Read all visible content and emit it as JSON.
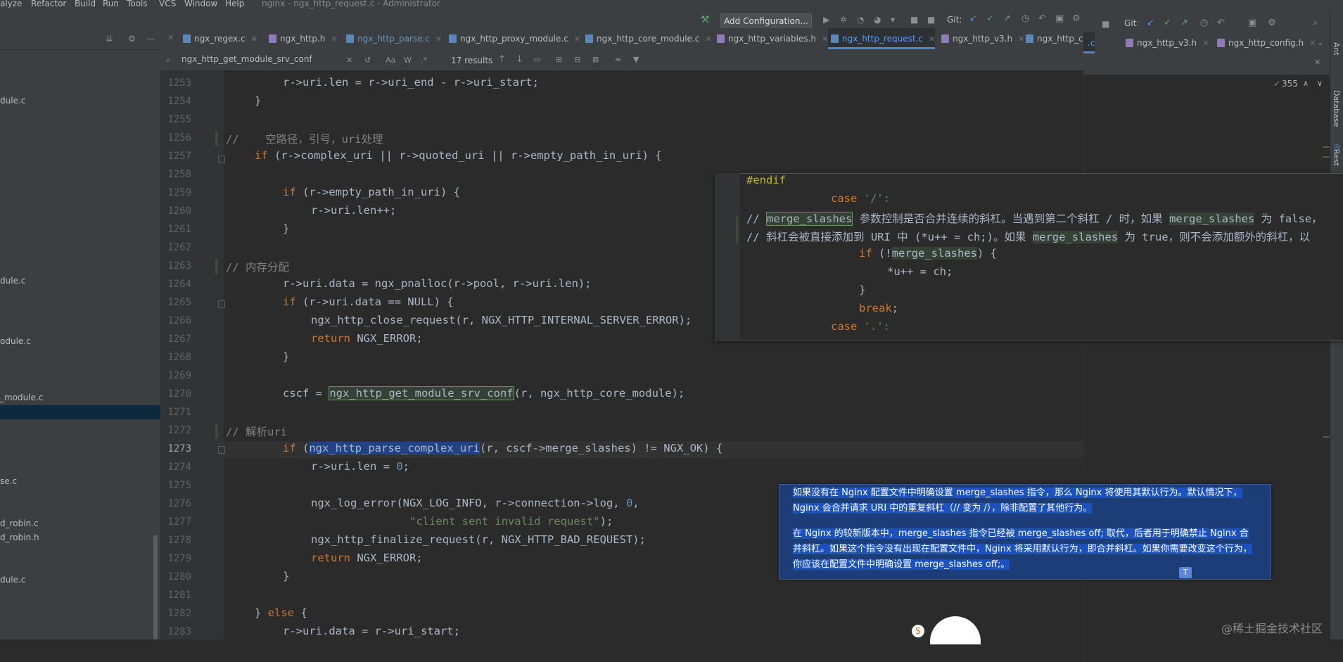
{
  "menu": {
    "items": [
      "alyze",
      "Refactor",
      "Build",
      "Run",
      "Tools",
      "VCS",
      "Window",
      "Help"
    ],
    "title": "nginx - ngx_http_request.c - Administrator"
  },
  "toolbar": {
    "add_config": "Add Configuration...",
    "git_label": "Git:"
  },
  "tabs": [
    {
      "label": "ngx_regex.c"
    },
    {
      "label": "ngx_http.h"
    },
    {
      "label": "ngx_http_parse.c"
    },
    {
      "label": "ngx_http_proxy_module.c"
    },
    {
      "label": "ngx_http_core_module.c"
    },
    {
      "label": "ngx_http_variables.h"
    },
    {
      "label": "ngx_http_request.c"
    },
    {
      "label": "ngx_http_v3.h"
    },
    {
      "label": "ngx_http_co"
    }
  ],
  "right_tabs": [
    {
      "label": ".c"
    },
    {
      "label": "ngx_http_v3.h"
    },
    {
      "label": "ngx_http_config.h"
    }
  ],
  "search": {
    "query": "ngx_http_get_module_srv_conf",
    "results": "17 results",
    "aa": "Aa",
    "w": "W",
    "regex": ".*"
  },
  "inspections": {
    "count": "355"
  },
  "left_tree": [
    {
      "label": "dule.c"
    },
    {
      "label": "dule.c"
    },
    {
      "label": "odule.c"
    },
    {
      "label": "_module.c"
    },
    {
      "label": "se.c"
    },
    {
      "label": "d_robin.c"
    },
    {
      "label": "d_robin.h"
    },
    {
      "label": "dule.c"
    }
  ],
  "line_numbers": [
    "1253",
    "1254",
    "1255",
    "1256",
    "1257",
    "1258",
    "1259",
    "1260",
    "1261",
    "1262",
    "1263",
    "1264",
    "1265",
    "1266",
    "1267",
    "1268",
    "1269",
    "1270",
    "1271",
    "1272",
    "1273",
    "1274",
    "1275",
    "1276",
    "1277",
    "1278",
    "1279",
    "1280",
    "1281",
    "1282",
    "1283"
  ],
  "code": {
    "l1253": "r->uri.len = r->uri_end - r->uri_start;",
    "l1254": "}",
    "l1256": "//    空路径，引号，uri处理",
    "l1257_a": "if",
    "l1257_b": " (r->complex_uri || r->quoted_uri || r->empty_path_in_uri) {",
    "l1259_a": "if",
    "l1259_b": " (r->empty_path_in_uri) {",
    "l1260": "r->uri.len++;",
    "l1261": "}",
    "l1263": "// 内存分配",
    "l1264": "r->uri.data = ngx_pnalloc(r->pool, r->uri.len);",
    "l1265_a": "if",
    "l1265_b": " (r->uri.data == NULL) {",
    "l1266": "ngx_http_close_request(r, NGX_HTTP_INTERNAL_SERVER_ERROR);",
    "l1267_a": "return",
    "l1267_b": " NGX_ERROR;",
    "l1268": "}",
    "l1270_a": "cscf = ",
    "l1270_b": "ngx_http_get_module_srv_conf",
    "l1270_c": "(r, ngx_http_core_module);",
    "l1272": "// 解析uri",
    "l1273_a": "if",
    "l1273_b": " (",
    "l1273_c": "ngx_http_parse_complex_uri",
    "l1273_d": "(r, cscf->merge_slashes) != NGX_OK) {",
    "l1274_a": "r->uri.len = ",
    "l1274_b": "0",
    "l1274_c": ";",
    "l1276_a": "ngx_log_error(NGX_LOG_INFO, r->connection->log, ",
    "l1276_b": "0",
    "l1276_c": ",",
    "l1277": "\"client sent invalid request\"",
    "l1277_b": ");",
    "l1278": "ngx_http_finalize_request(r, NGX_HTTP_BAD_REQUEST);",
    "l1279_a": "return",
    "l1279_b": " NGX_ERROR;",
    "l1280": "}",
    "l1282_a": "} ",
    "l1282_b": "else",
    "l1282_c": " {",
    "l1283": "r->uri.data = r->uri_start;"
  },
  "popup": {
    "endif": "#endif",
    "case1_a": "case",
    "case1_b": " '/':",
    "c1_a": "// ",
    "c1_b": "merge_slashes",
    "c1_c": " 参数控制是否合并连续的斜杠。当遇到第二个斜杠 / 时，如果 ",
    "c1_d": "merge_slashes",
    "c1_e": " 为 false，",
    "c2_a": "// 斜杠会被直接添加到 URI 中 (*u++ = ch;)。如果 ",
    "c2_b": "merge_slashes",
    "c2_c": " 为 true，则不会添加额外的斜杠，以",
    "if_a": "if",
    "if_b": " (!",
    "if_c": "merge_slashes",
    "if_d": ") {",
    "assign": "*u++ = ch;",
    "close": "}",
    "brk": "break",
    "brk2": ";",
    "case2_a": "case",
    "case2_b": " '.':"
  },
  "translation": {
    "p1": "如果没有在 Nginx 配置文件中明确设置 merge_slashes 指令，那么 Nginx 将使用其默认行为。默认情况下，Nginx 会合并请求 URI 中的重复斜杠（// 变为 /），除非配置了其他行为。",
    "p2": "在 Nginx 的较新版本中，merge_slashes 指令已经被 merge_slashes off; 取代，后者用于明确禁止 Nginx 合并斜杠。如果这个指令没有出现在配置文件中，Nginx 将采用默认行为，即合并斜杠。如果你需要改变这个行为，你应该在配置文件中明确设置 merge_slashes off;。",
    "btn": "T"
  },
  "side_tools": [
    "Ant",
    "Database",
    "Rest"
  ],
  "watermark": "@稀土掘金技术社区",
  "colors": {
    "keyword": "#cc7832",
    "comment": "#808080",
    "string": "#6a8759",
    "number": "#6897bb",
    "selection": "#214283",
    "search_match": "#344134"
  }
}
